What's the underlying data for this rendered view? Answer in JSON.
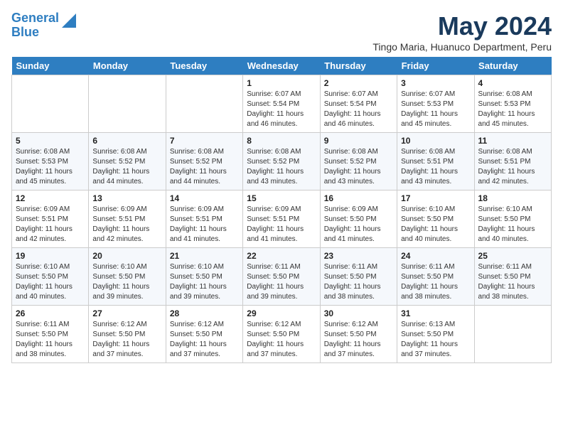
{
  "logo": {
    "line1": "General",
    "line2": "Blue"
  },
  "title": "May 2024",
  "location": "Tingo Maria, Huanuco Department, Peru",
  "days_of_week": [
    "Sunday",
    "Monday",
    "Tuesday",
    "Wednesday",
    "Thursday",
    "Friday",
    "Saturday"
  ],
  "weeks": [
    [
      {
        "day": "",
        "info": ""
      },
      {
        "day": "",
        "info": ""
      },
      {
        "day": "",
        "info": ""
      },
      {
        "day": "1",
        "info": "Sunrise: 6:07 AM\nSunset: 5:54 PM\nDaylight: 11 hours\nand 46 minutes."
      },
      {
        "day": "2",
        "info": "Sunrise: 6:07 AM\nSunset: 5:54 PM\nDaylight: 11 hours\nand 46 minutes."
      },
      {
        "day": "3",
        "info": "Sunrise: 6:07 AM\nSunset: 5:53 PM\nDaylight: 11 hours\nand 45 minutes."
      },
      {
        "day": "4",
        "info": "Sunrise: 6:08 AM\nSunset: 5:53 PM\nDaylight: 11 hours\nand 45 minutes."
      }
    ],
    [
      {
        "day": "5",
        "info": "Sunrise: 6:08 AM\nSunset: 5:53 PM\nDaylight: 11 hours\nand 45 minutes."
      },
      {
        "day": "6",
        "info": "Sunrise: 6:08 AM\nSunset: 5:52 PM\nDaylight: 11 hours\nand 44 minutes."
      },
      {
        "day": "7",
        "info": "Sunrise: 6:08 AM\nSunset: 5:52 PM\nDaylight: 11 hours\nand 44 minutes."
      },
      {
        "day": "8",
        "info": "Sunrise: 6:08 AM\nSunset: 5:52 PM\nDaylight: 11 hours\nand 43 minutes."
      },
      {
        "day": "9",
        "info": "Sunrise: 6:08 AM\nSunset: 5:52 PM\nDaylight: 11 hours\nand 43 minutes."
      },
      {
        "day": "10",
        "info": "Sunrise: 6:08 AM\nSunset: 5:51 PM\nDaylight: 11 hours\nand 43 minutes."
      },
      {
        "day": "11",
        "info": "Sunrise: 6:08 AM\nSunset: 5:51 PM\nDaylight: 11 hours\nand 42 minutes."
      }
    ],
    [
      {
        "day": "12",
        "info": "Sunrise: 6:09 AM\nSunset: 5:51 PM\nDaylight: 11 hours\nand 42 minutes."
      },
      {
        "day": "13",
        "info": "Sunrise: 6:09 AM\nSunset: 5:51 PM\nDaylight: 11 hours\nand 42 minutes."
      },
      {
        "day": "14",
        "info": "Sunrise: 6:09 AM\nSunset: 5:51 PM\nDaylight: 11 hours\nand 41 minutes."
      },
      {
        "day": "15",
        "info": "Sunrise: 6:09 AM\nSunset: 5:51 PM\nDaylight: 11 hours\nand 41 minutes."
      },
      {
        "day": "16",
        "info": "Sunrise: 6:09 AM\nSunset: 5:50 PM\nDaylight: 11 hours\nand 41 minutes."
      },
      {
        "day": "17",
        "info": "Sunrise: 6:10 AM\nSunset: 5:50 PM\nDaylight: 11 hours\nand 40 minutes."
      },
      {
        "day": "18",
        "info": "Sunrise: 6:10 AM\nSunset: 5:50 PM\nDaylight: 11 hours\nand 40 minutes."
      }
    ],
    [
      {
        "day": "19",
        "info": "Sunrise: 6:10 AM\nSunset: 5:50 PM\nDaylight: 11 hours\nand 40 minutes."
      },
      {
        "day": "20",
        "info": "Sunrise: 6:10 AM\nSunset: 5:50 PM\nDaylight: 11 hours\nand 39 minutes."
      },
      {
        "day": "21",
        "info": "Sunrise: 6:10 AM\nSunset: 5:50 PM\nDaylight: 11 hours\nand 39 minutes."
      },
      {
        "day": "22",
        "info": "Sunrise: 6:11 AM\nSunset: 5:50 PM\nDaylight: 11 hours\nand 39 minutes."
      },
      {
        "day": "23",
        "info": "Sunrise: 6:11 AM\nSunset: 5:50 PM\nDaylight: 11 hours\nand 38 minutes."
      },
      {
        "day": "24",
        "info": "Sunrise: 6:11 AM\nSunset: 5:50 PM\nDaylight: 11 hours\nand 38 minutes."
      },
      {
        "day": "25",
        "info": "Sunrise: 6:11 AM\nSunset: 5:50 PM\nDaylight: 11 hours\nand 38 minutes."
      }
    ],
    [
      {
        "day": "26",
        "info": "Sunrise: 6:11 AM\nSunset: 5:50 PM\nDaylight: 11 hours\nand 38 minutes."
      },
      {
        "day": "27",
        "info": "Sunrise: 6:12 AM\nSunset: 5:50 PM\nDaylight: 11 hours\nand 37 minutes."
      },
      {
        "day": "28",
        "info": "Sunrise: 6:12 AM\nSunset: 5:50 PM\nDaylight: 11 hours\nand 37 minutes."
      },
      {
        "day": "29",
        "info": "Sunrise: 6:12 AM\nSunset: 5:50 PM\nDaylight: 11 hours\nand 37 minutes."
      },
      {
        "day": "30",
        "info": "Sunrise: 6:12 AM\nSunset: 5:50 PM\nDaylight: 11 hours\nand 37 minutes."
      },
      {
        "day": "31",
        "info": "Sunrise: 6:13 AM\nSunset: 5:50 PM\nDaylight: 11 hours\nand 37 minutes."
      },
      {
        "day": "",
        "info": ""
      }
    ]
  ]
}
